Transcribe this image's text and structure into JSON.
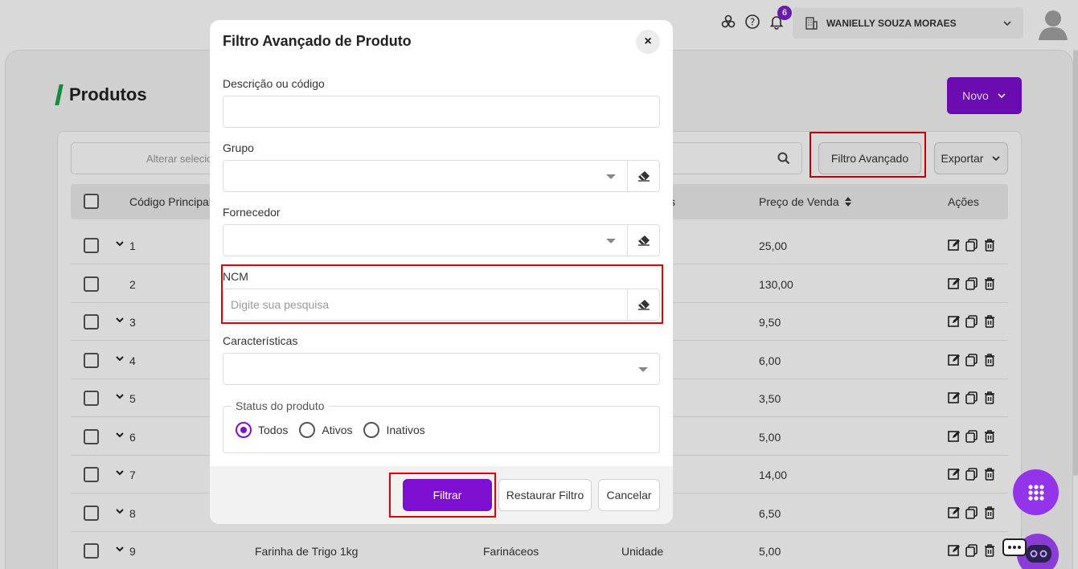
{
  "header": {
    "notification_count": "6",
    "user_name": "WANIELLY SOUZA MORAES"
  },
  "page": {
    "title": "Produtos",
    "new_button": "Novo",
    "search_placeholder": "Alterar selecio",
    "advanced_filter_button": "Filtro Avançado",
    "export_button": "Exportar"
  },
  "table": {
    "columns": {
      "code": "Código Principal",
      "sale_price": "Preço de Venda",
      "actions": "Ações",
      "partial_col": "s"
    },
    "rows": [
      {
        "code": "1",
        "expandable": true,
        "name": "",
        "group": "",
        "unit": "",
        "price": "25,00"
      },
      {
        "code": "2",
        "expandable": false,
        "name": "",
        "group": "",
        "unit": "",
        "price": "130,00"
      },
      {
        "code": "3",
        "expandable": true,
        "name": "",
        "group": "",
        "unit": "",
        "price": "9,50"
      },
      {
        "code": "4",
        "expandable": true,
        "name": "",
        "group": "",
        "unit": "",
        "price": "6,00"
      },
      {
        "code": "5",
        "expandable": true,
        "name": "",
        "group": "",
        "unit": "",
        "price": "3,50"
      },
      {
        "code": "6",
        "expandable": true,
        "name": "",
        "group": "",
        "unit": "",
        "price": "5,00"
      },
      {
        "code": "7",
        "expandable": true,
        "name": "",
        "group": "",
        "unit": "",
        "price": "14,00"
      },
      {
        "code": "8",
        "expandable": true,
        "name": "",
        "group": "",
        "unit": "",
        "price": "6,50"
      },
      {
        "code": "9",
        "expandable": true,
        "name": "Farinha de Trigo 1kg",
        "group": "Farináceos",
        "unit": "Unidade",
        "price": "5,00"
      }
    ]
  },
  "modal": {
    "title": "Filtro Avançado de Produto",
    "close_label": "×",
    "description_label": "Descrição ou código",
    "description_value": "",
    "group_label": "Grupo",
    "supplier_label": "Fornecedor",
    "ncm_label": "NCM",
    "ncm_placeholder": "Digite sua pesquisa",
    "features_label": "Características",
    "status_legend": "Status do produto",
    "status_options": [
      "Todos",
      "Ativos",
      "Inativos"
    ],
    "status_selected": "Todos",
    "filter_button": "Filtrar",
    "reset_button": "Restaurar Filtro",
    "cancel_button": "Cancelar"
  },
  "colors": {
    "primary": "#7e0fd1",
    "accent_green": "#16a34a",
    "highlight_red": "#e00000"
  }
}
